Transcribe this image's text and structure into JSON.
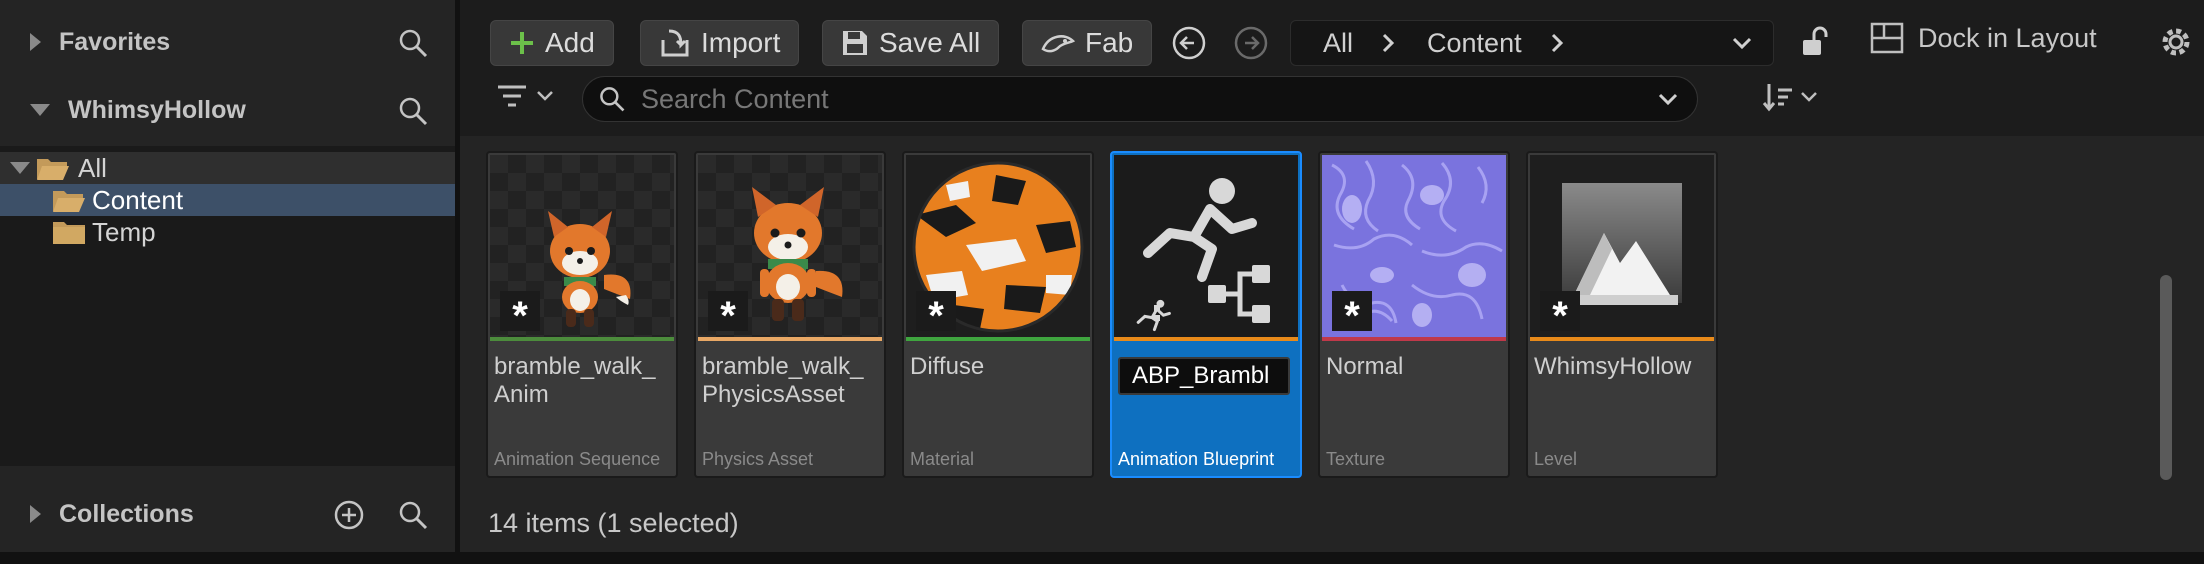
{
  "sidebar": {
    "favorites": {
      "label": "Favorites"
    },
    "project": {
      "label": "WhimsyHollow"
    },
    "tree": [
      {
        "label": "All"
      },
      {
        "label": "Content"
      },
      {
        "label": "Temp"
      }
    ],
    "collections": {
      "label": "Collections"
    }
  },
  "toolbar": {
    "add_label": "Add",
    "import_label": "Import",
    "save_all_label": "Save All",
    "fab_label": "Fab",
    "breadcrumb": [
      "All",
      "Content"
    ],
    "dock_label": "Dock in Layout"
  },
  "search": {
    "placeholder": "Search Content"
  },
  "assets": [
    {
      "name": "bramble_walk_\nAnim",
      "type": "Animation Sequence",
      "strip_color": "#4c8c3c"
    },
    {
      "name": "bramble_walk_\nPhysicsAsset",
      "type": "Physics Asset",
      "strip_color": "#e9a865"
    },
    {
      "name": "Diffuse",
      "type": "Material",
      "strip_color": "#3fa53f"
    },
    {
      "name": "ABP_Brambl",
      "type": "Animation Blueprint",
      "strip_color": "#e88a1a"
    },
    {
      "name": "Normal",
      "type": "Texture",
      "strip_color": "#c0394a"
    },
    {
      "name": "WhimsyHollow",
      "type": "Level",
      "strip_color": "#e88a1a"
    }
  ],
  "status": {
    "text": "14 items (1 selected)"
  },
  "colors": {
    "selected_tile": "#0e70c0",
    "accent_add": "#6cc04a"
  }
}
